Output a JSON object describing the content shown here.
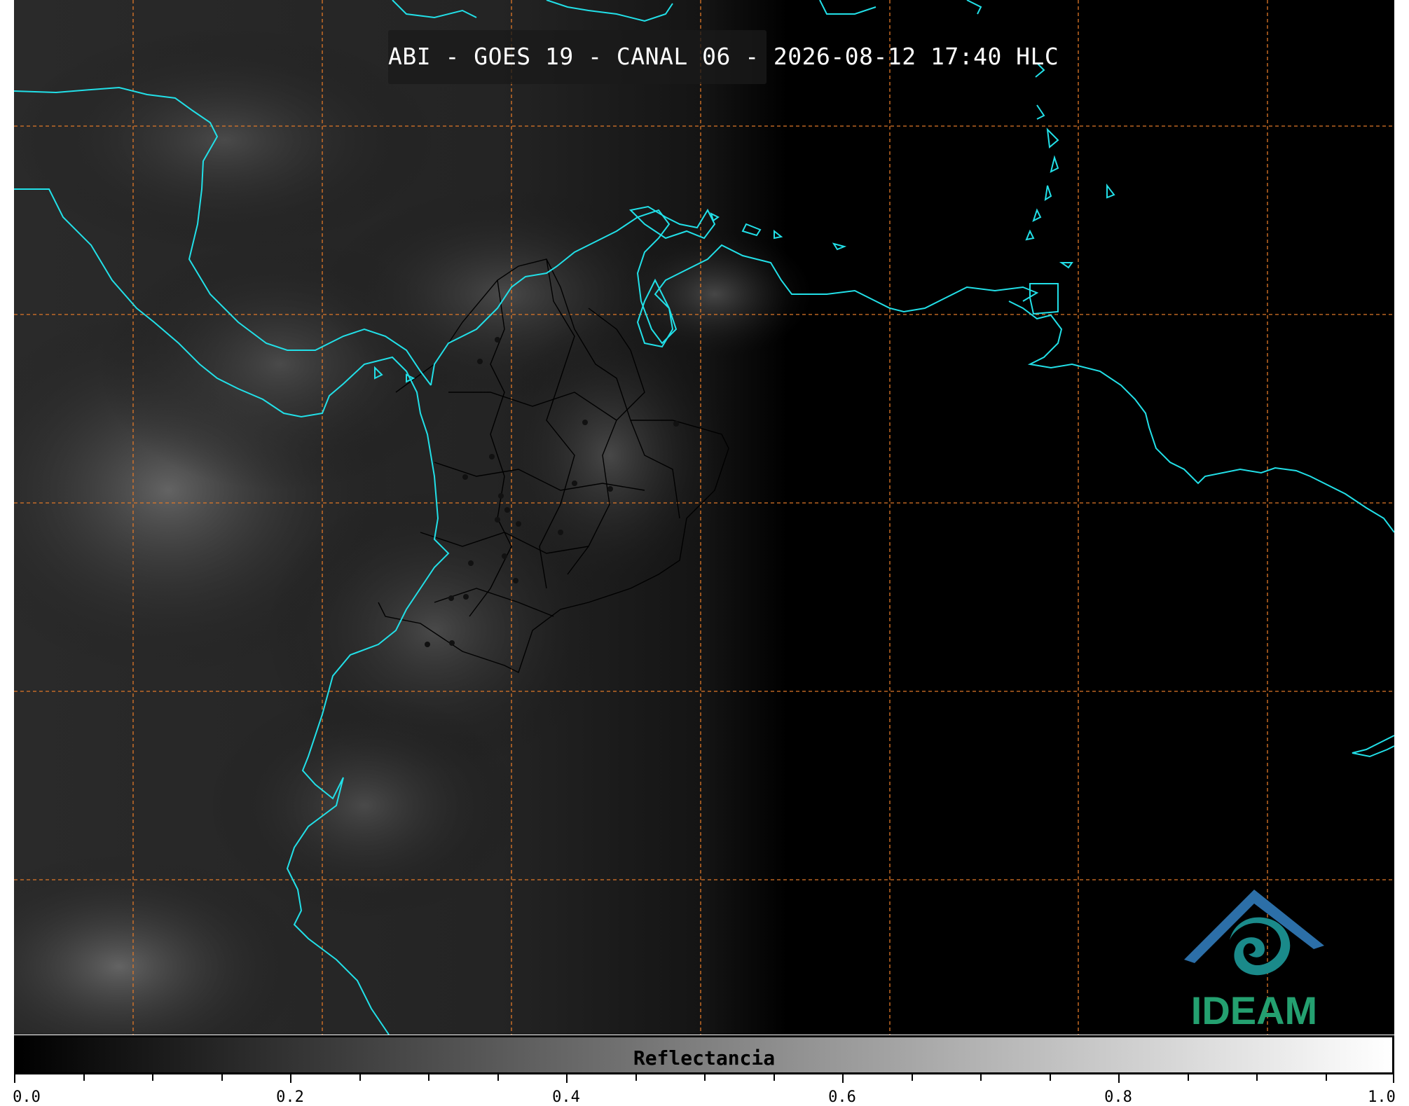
{
  "title": "ABI - GOES 19 - CANAL 06 - 2026-08-12 17:40 HLC",
  "colorbar": {
    "label": "Reflectancia",
    "ticks": [
      "0.0",
      "0.2",
      "0.4",
      "0.6",
      "0.8",
      "1.0"
    ],
    "range": [
      0.0,
      1.0
    ],
    "colors": {
      "low": "#000000",
      "high": "#ffffff"
    }
  },
  "logo": {
    "text": "IDEAM",
    "colors": {
      "roof": "#2c6fa8",
      "spiral": "#1a8a8a",
      "text": "#24a070"
    }
  },
  "map": {
    "coastline_color": "#22e0e8",
    "gridline_color": "#e07828",
    "border_color": "#000000"
  }
}
